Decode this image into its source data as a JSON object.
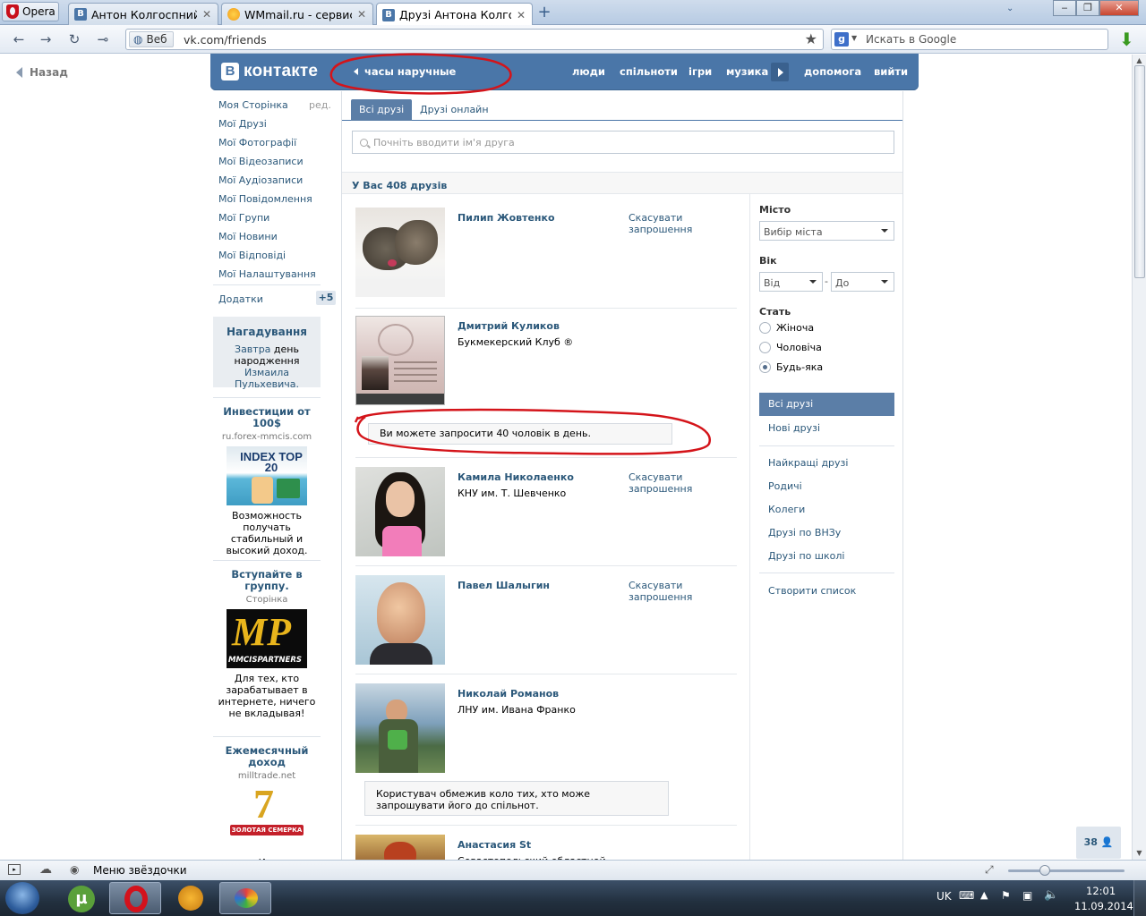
{
  "browser": {
    "menu_label": "Opera",
    "tabs": [
      {
        "label": "Антон Колгоспний",
        "icon": "vk-favicon"
      },
      {
        "label": "WMmail.ru - сервис п...",
        "icon": "wmmail-favicon"
      },
      {
        "label": "Друзі Антона Колгоспн...",
        "icon": "vk-favicon"
      }
    ],
    "address_badge": "Веб",
    "url": "vk.com/friends",
    "search_placeholder": "Искать в Google"
  },
  "back_link": "Назад",
  "header": {
    "logo_letter": "B",
    "logo": "контакте",
    "back_item": "часы наручные",
    "nav": [
      "люди",
      "спільноти",
      "ігри",
      "музика",
      "допомога",
      "вийти"
    ]
  },
  "left_menu": {
    "items": [
      "Моя Сторінка",
      "Мої Друзі",
      "Мої Фотографії",
      "Мої Відеозаписи",
      "Мої Аудіозаписи",
      "Мої Повідомлення",
      "Мої Групи",
      "Мої Новини",
      "Мої Відповіді",
      "Мої Налаштування"
    ],
    "edit_label": "ред.",
    "apps_label": "Додатки",
    "apps_badge": "+5"
  },
  "reminder": {
    "title": "Нагадування",
    "when": "Завтра",
    "text_mid": " день народження ",
    "person": "Измаила Пульхевича."
  },
  "ads": [
    {
      "title": "Инвестиции от 100$",
      "domain": "ru.forex-mmcis.com",
      "image_text": "INDEX TOP 20",
      "description": "Возможность получать стабильный и высокий доход."
    },
    {
      "title": "Вступайте в группу.",
      "domain": "Сторінка",
      "image_text": "MP",
      "image_subtext": "MMCISPARTNERS",
      "description": "Для тех, кто зарабатывает в интернете, ничего не вкладывая!"
    },
    {
      "title": "Ежемесячный доход",
      "domain": "milltrade.net",
      "image_text": "7",
      "image_subtext": "ЗОЛОТАЯ СЕМЕРКА",
      "description": "И..."
    }
  ],
  "content": {
    "tabs": [
      "Всі друзі",
      "Друзі онлайн"
    ],
    "search_placeholder": "Почніть вводити ім'я друга",
    "count_text": "У Вас 408 друзів",
    "friends": [
      {
        "name": "Пилип Жовтенко",
        "subtitle": "",
        "action": "Скасувати запрошення"
      },
      {
        "name": "Дмитрий Куликов",
        "subtitle": "Букмекерский Клуб ®",
        "action": ""
      },
      {
        "name": "Камила Николаенко",
        "subtitle": "КНУ им. Т. Шевченко",
        "action": "Скасувати запрошення"
      },
      {
        "name": "Павел Шалыгин",
        "subtitle": "",
        "action": "Скасувати запрошення"
      },
      {
        "name": "Николай Романов",
        "subtitle": "ЛНУ им. Ивана Франко",
        "action": ""
      },
      {
        "name": "Анастасия St",
        "subtitle": "Севастопольский областной эко...",
        "action": ""
      }
    ],
    "notice_limit": "Ви можете запросити 40 чоловік в день.",
    "notice_restricted": "Користувач обмежив коло тих, хто може запрошувати його до спільнот."
  },
  "filters": {
    "city_label": "Місто",
    "city_select": "Вибір міста",
    "age_label": "Вік",
    "age_from": "Від",
    "age_dash": "-",
    "age_to": "До",
    "gender_label": "Стать",
    "gender_options": [
      "Жіноча",
      "Чоловіча",
      "Будь-яка"
    ],
    "gender_selected": 2,
    "lists": [
      "Всі друзі",
      "Нові друзі"
    ],
    "categories": [
      "Найкращі друзі",
      "Родичі",
      "Колеги",
      "Друзі по ВНЗу",
      "Друзі по школі"
    ],
    "create_list": "Створити список"
  },
  "online_badge": "38",
  "status_bar": {
    "text": "Меню звёздочки"
  },
  "taskbar": {
    "lang": "UK",
    "time": "12:01",
    "date": "11.09.2014"
  },
  "colors": {
    "vk_blue": "#4a76a8",
    "link": "#2b587a",
    "annotation_red": "#d4141a"
  }
}
